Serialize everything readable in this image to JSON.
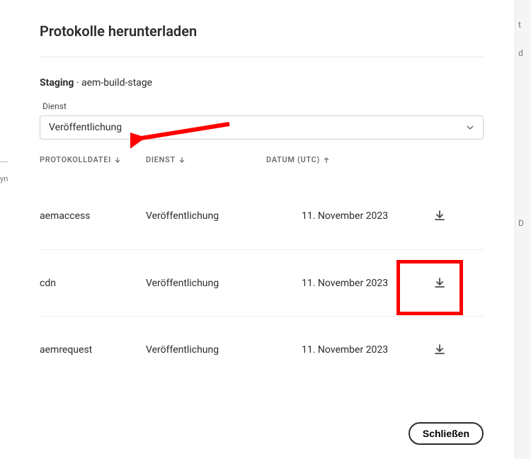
{
  "title": "Protokolle herunterladen",
  "env": {
    "label": "Staging",
    "name": "aem-build-stage"
  },
  "service_field": {
    "label": "Dienst",
    "selected": "Veröffentlichung"
  },
  "columns": {
    "file": "PROTOKOLLDATEI",
    "service": "DIENST",
    "date": "DATUM (UTC)"
  },
  "rows": [
    {
      "file": "aemaccess",
      "service": "Veröffentlichung",
      "date": "11. November 2023"
    },
    {
      "file": "cdn",
      "service": "Veröffentlichung",
      "date": "11. November 2023"
    },
    {
      "file": "aemrequest",
      "service": "Veröffentlichung",
      "date": "11. November 2023"
    }
  ],
  "close_label": "Schließen",
  "annotation": {
    "highlight_row_index": 1
  },
  "bg_fragments": {
    "right_top": "t",
    "right_mid": "d",
    "right_low": "D",
    "left": "yn"
  }
}
